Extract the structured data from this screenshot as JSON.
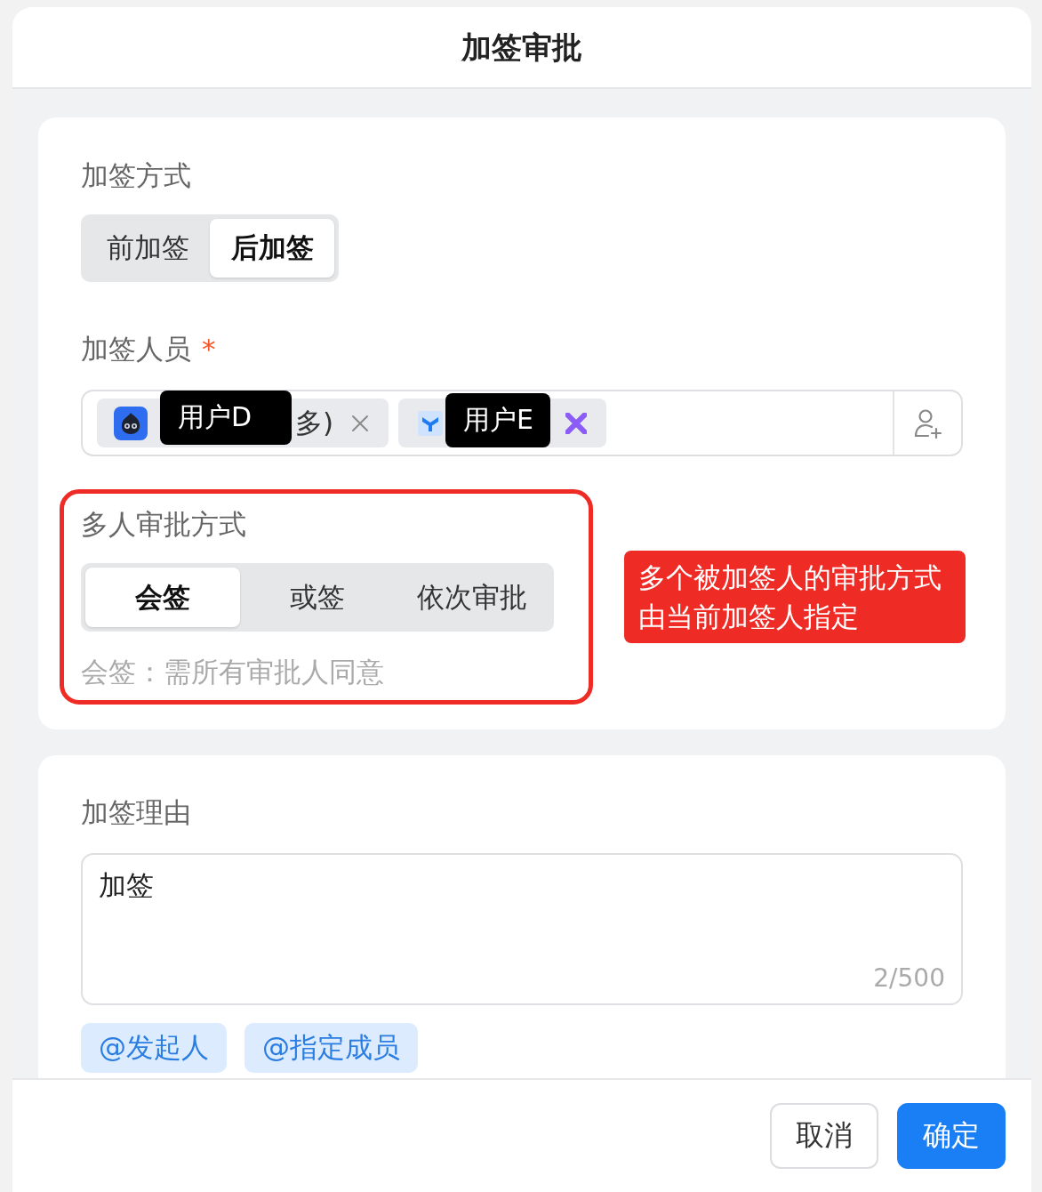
{
  "dialog": {
    "title": "加签审批"
  },
  "add_mode": {
    "label": "加签方式",
    "options": [
      {
        "label": "前加签",
        "selected": false
      },
      {
        "label": "后加签",
        "selected": true
      }
    ]
  },
  "signers": {
    "label": "加签人员",
    "required_mark": "*",
    "chips": [
      {
        "kind": "bot",
        "overlay_label": "用户D",
        "name": "多)",
        "close_hovered": false
      },
      {
        "kind": "app",
        "overlay_label": "用户E",
        "close_hovered": true
      }
    ]
  },
  "multi_approval": {
    "highlighted": true,
    "label": "多人审批方式",
    "options": [
      {
        "label": "会签",
        "selected": true
      },
      {
        "label": "或签",
        "selected": false
      },
      {
        "label": "依次审批",
        "selected": false
      }
    ],
    "hint": "会签：需所有审批人同意"
  },
  "annotation": {
    "lines": [
      "多个被加签人的审批方式",
      "由当前加签人指定"
    ]
  },
  "reason": {
    "label": "加签理由",
    "value": "加签",
    "counter": "2/500",
    "mentions": [
      "@发起人",
      "@指定成员"
    ]
  },
  "footer": {
    "buttons": [
      {
        "label": "取消",
        "kind": "secondary"
      },
      {
        "label": "确定",
        "kind": "primary"
      }
    ]
  }
}
